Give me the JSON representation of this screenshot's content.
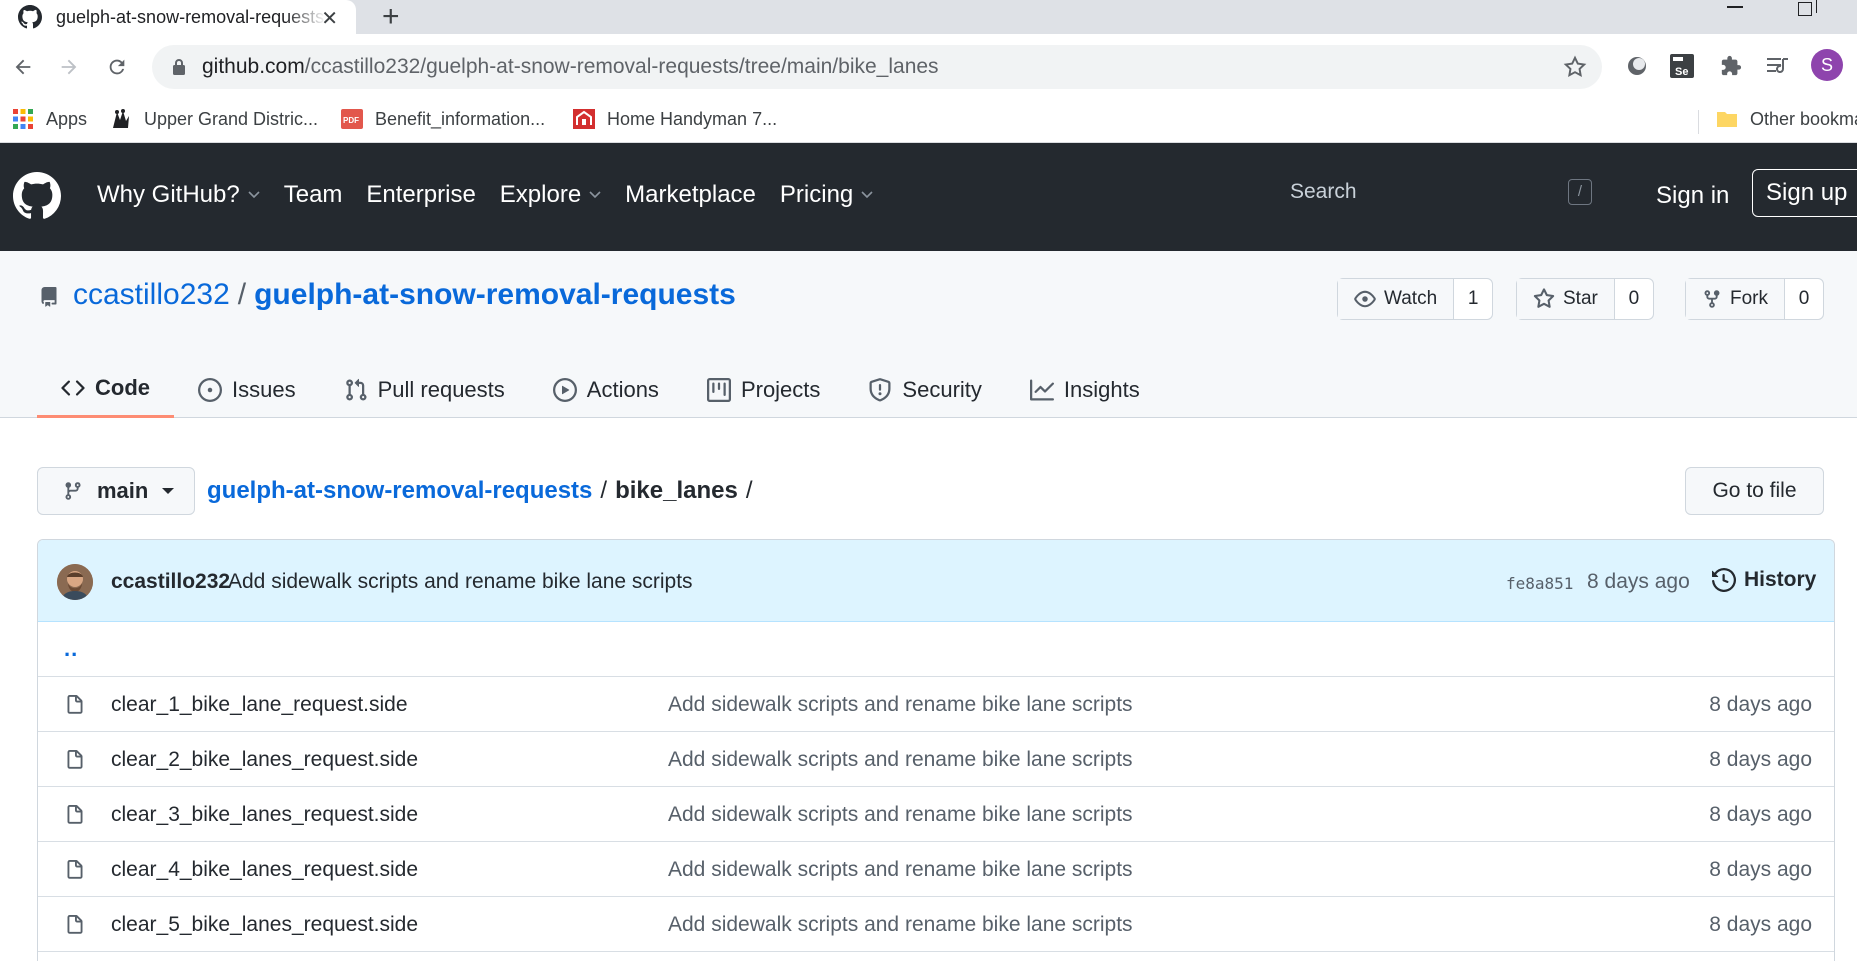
{
  "browser": {
    "tab_title": "guelph-at-snow-removal-requests/bike_lanes",
    "url_host": "github.com",
    "url_path": "/ccastillo232/guelph-at-snow-removal-requests/tree/main/bike_lanes",
    "profile_initial": "S",
    "bookmarks": [
      {
        "label": "Apps",
        "icon": "apps-grid-icon"
      },
      {
        "label": "Upper Grand Distric...",
        "icon": "school-logo-icon"
      },
      {
        "label": "Benefit_information...",
        "icon": "pdf-icon"
      },
      {
        "label": "Home Handyman 7...",
        "icon": "home-hardware-icon"
      }
    ],
    "other_bookmarks": "Other bookmarks"
  },
  "header": {
    "nav": [
      {
        "label": "Why GitHub?",
        "dropdown": true
      },
      {
        "label": "Team",
        "dropdown": false
      },
      {
        "label": "Enterprise",
        "dropdown": false
      },
      {
        "label": "Explore",
        "dropdown": true
      },
      {
        "label": "Marketplace",
        "dropdown": false
      },
      {
        "label": "Pricing",
        "dropdown": true
      }
    ],
    "search_placeholder": "Search",
    "search_key": "/",
    "sign_in": "Sign in",
    "sign_up": "Sign up"
  },
  "repo": {
    "owner": "ccastillo232",
    "separator": "/",
    "name": "guelph-at-snow-removal-requests",
    "watch": {
      "label": "Watch",
      "count": "1"
    },
    "star": {
      "label": "Star",
      "count": "0"
    },
    "fork": {
      "label": "Fork",
      "count": "0"
    },
    "tabs": [
      {
        "label": "Code",
        "icon": "code-icon",
        "active": true
      },
      {
        "label": "Issues",
        "icon": "issue-icon",
        "active": false
      },
      {
        "label": "Pull requests",
        "icon": "pull-request-icon",
        "active": false
      },
      {
        "label": "Actions",
        "icon": "play-icon",
        "active": false
      },
      {
        "label": "Projects",
        "icon": "project-icon",
        "active": false
      },
      {
        "label": "Security",
        "icon": "shield-icon",
        "active": false
      },
      {
        "label": "Insights",
        "icon": "graph-icon",
        "active": false
      }
    ]
  },
  "file_nav": {
    "branch": "main",
    "breadcrumb_root": "guelph-at-snow-removal-requests",
    "breadcrumb_sep": "/",
    "breadcrumb_current": "bike_lanes",
    "breadcrumb_trailing": "/",
    "go_to_file": "Go to file"
  },
  "commit": {
    "author": "ccastillo232",
    "message": "Add sidewalk scripts and rename bike lane scripts",
    "sha": "fe8a851",
    "time": "8 days ago",
    "history": "History"
  },
  "parent_dir": "..",
  "files": [
    {
      "name": "clear_1_bike_lane_request.side",
      "message": "Add sidewalk scripts and rename bike lane scripts",
      "age": "8 days ago"
    },
    {
      "name": "clear_2_bike_lanes_request.side",
      "message": "Add sidewalk scripts and rename bike lane scripts",
      "age": "8 days ago"
    },
    {
      "name": "clear_3_bike_lanes_request.side",
      "message": "Add sidewalk scripts and rename bike lane scripts",
      "age": "8 days ago"
    },
    {
      "name": "clear_4_bike_lanes_request.side",
      "message": "Add sidewalk scripts and rename bike lane scripts",
      "age": "8 days ago"
    },
    {
      "name": "clear_5_bike_lanes_request.side",
      "message": "Add sidewalk scripts and rename bike lane scripts",
      "age": "8 days ago"
    }
  ],
  "colors": {
    "header_bg": "#24292f",
    "link": "#0969da",
    "active_tab_underline": "#fd8c73",
    "commit_bar_bg": "#ddf4ff"
  }
}
